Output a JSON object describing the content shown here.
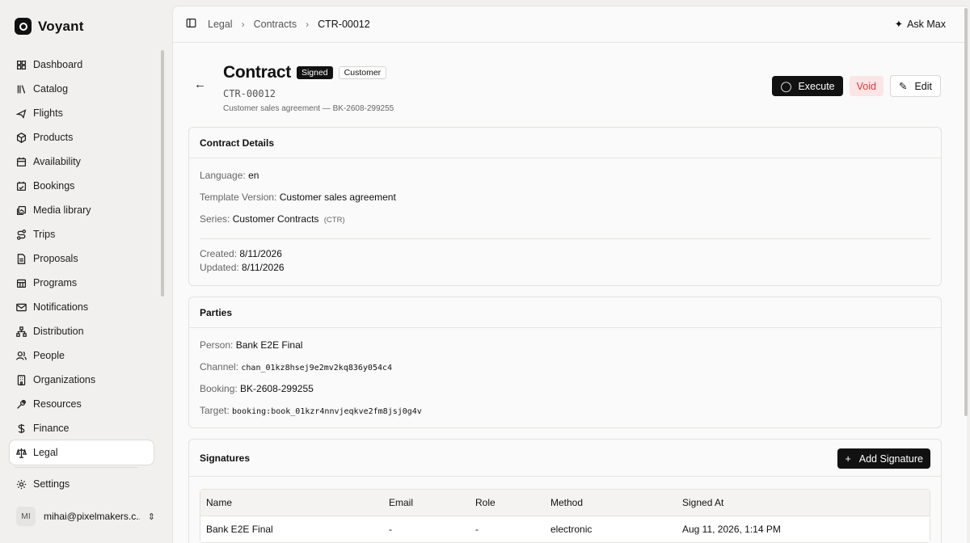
{
  "app": {
    "name": "Voyant",
    "logo_icon": "voyant-logo-icon"
  },
  "sidebar": {
    "items": [
      {
        "label": "Dashboard",
        "icon": "dashboard-icon"
      },
      {
        "label": "Catalog",
        "icon": "catalog-icon"
      },
      {
        "label": "Flights",
        "icon": "plane-icon"
      },
      {
        "label": "Products",
        "icon": "package-icon"
      },
      {
        "label": "Availability",
        "icon": "calendar-icon"
      },
      {
        "label": "Bookings",
        "icon": "calendar-check-icon"
      },
      {
        "label": "Media library",
        "icon": "image-icon"
      },
      {
        "label": "Trips",
        "icon": "route-icon"
      },
      {
        "label": "Proposals",
        "icon": "document-icon"
      },
      {
        "label": "Programs",
        "icon": "calendar-grid-icon"
      },
      {
        "label": "Notifications",
        "icon": "mail-icon"
      },
      {
        "label": "Distribution",
        "icon": "network-icon"
      },
      {
        "label": "People",
        "icon": "users-icon"
      },
      {
        "label": "Organizations",
        "icon": "building-icon"
      },
      {
        "label": "Resources",
        "icon": "wrench-icon"
      },
      {
        "label": "Finance",
        "icon": "dollar-icon"
      },
      {
        "label": "Legal",
        "icon": "scale-icon",
        "active": true
      }
    ],
    "settings": {
      "label": "Settings",
      "icon": "gear-icon"
    },
    "user": {
      "initials": "MI",
      "email": "mihai@pixelmakers.c..."
    }
  },
  "topbar": {
    "breadcrumbs": [
      "Legal",
      "Contracts",
      "CTR-00012"
    ],
    "ask_label": "Ask Max"
  },
  "header": {
    "title": "Contract",
    "status_badge": "Signed",
    "type_badge": "Customer",
    "id": "CTR-00012",
    "subtitle": "Customer sales agreement — BK-2608-299255",
    "execute_label": "Execute",
    "void_label": "Void",
    "edit_label": "Edit"
  },
  "details": {
    "heading": "Contract Details",
    "language_label": "Language:",
    "language": "en",
    "template_label": "Template Version:",
    "template": "Customer sales agreement",
    "series_label": "Series:",
    "series": "Customer Contracts",
    "series_code": "(CTR)",
    "created_label": "Created:",
    "created": "8/11/2026",
    "updated_label": "Updated:",
    "updated": "8/11/2026"
  },
  "parties": {
    "heading": "Parties",
    "person_label": "Person:",
    "person": "Bank E2E Final",
    "channel_label": "Channel:",
    "channel": "chan_01kz8hsej9e2mv2kq836y054c4",
    "booking_label": "Booking:",
    "booking": "BK-2608-299255",
    "target_label": "Target:",
    "target": "booking:book_01kzr4nnvjeqkve2fm8jsj0g4v"
  },
  "signatures": {
    "heading": "Signatures",
    "add_label": "Add Signature",
    "columns": [
      "Name",
      "Email",
      "Role",
      "Method",
      "Signed At"
    ],
    "rows": [
      [
        "Bank E2E Final",
        "-",
        "-",
        "electronic",
        "Aug 11, 2026, 1:14 PM"
      ]
    ]
  }
}
